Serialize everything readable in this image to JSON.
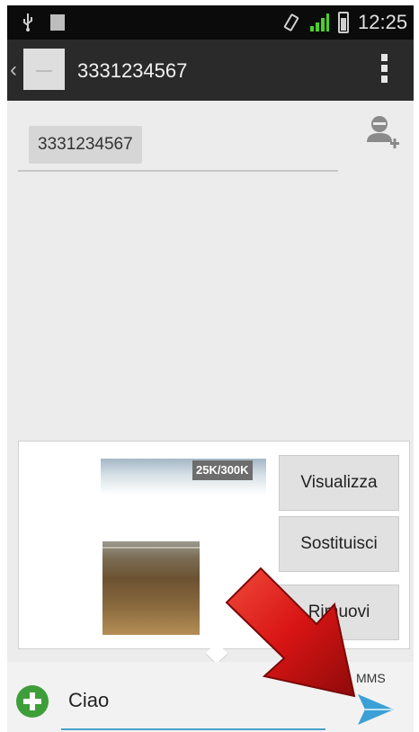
{
  "status_bar": {
    "time": "12:25",
    "icons": [
      "usb-icon",
      "sd-card-icon",
      "rotate-icon",
      "signal-icon",
      "battery-icon"
    ]
  },
  "action_bar": {
    "title": "3331234567",
    "back_icon": "chevron-left-icon",
    "menu_icon": "overflow-menu-icon"
  },
  "recipients": {
    "chips": [
      "3331234567"
    ],
    "add_contact_icon": "add-contact-icon"
  },
  "attachment": {
    "size_label": "25K/300K",
    "buttons": {
      "view": "Visualizza",
      "replace": "Sostituisci",
      "remove": "Rimuovi"
    }
  },
  "compose": {
    "message_text": "Ciao",
    "mms_label": "MMS",
    "add_icon": "add-attachment-icon",
    "send_icon": "send-icon"
  },
  "colors": {
    "accent_blue": "#4aa3c9",
    "add_green": "#3e9e3a",
    "signal_green": "#4cd12c",
    "arrow_red": "#d81414"
  }
}
